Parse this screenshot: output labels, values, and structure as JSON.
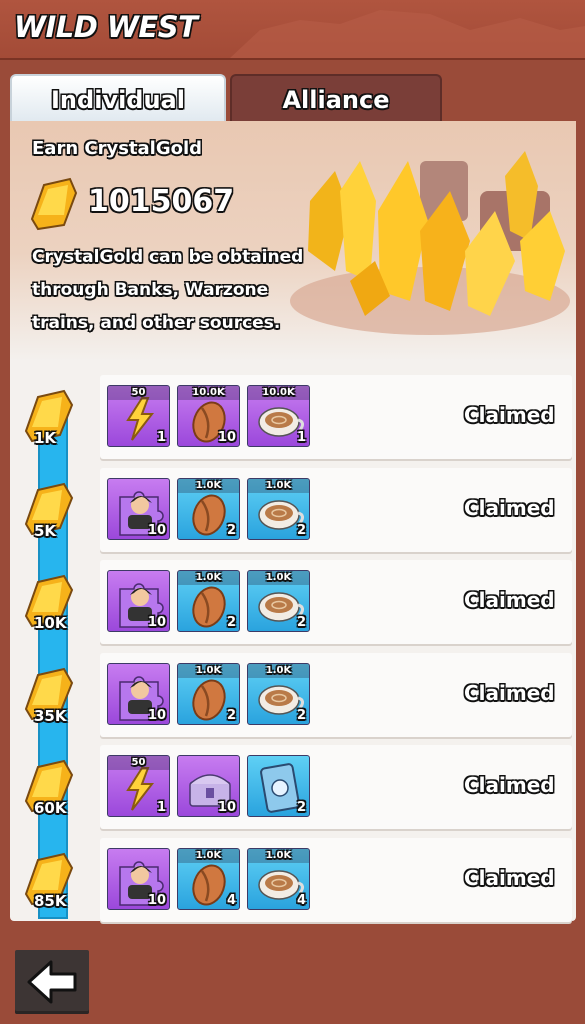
{
  "header": {
    "title": "WILD WEST"
  },
  "tabs": [
    {
      "label": "Individual",
      "active": true
    },
    {
      "label": "Alliance",
      "active": false
    }
  ],
  "hero": {
    "earn_label": "Earn CrystalGold",
    "amount": "1015067",
    "description": "CrystalGold can be obtained through Banks, Warzone trains, and other sources."
  },
  "rewards": [
    {
      "milestone": "1K",
      "status": "Claimed",
      "items": [
        {
          "icon": "energy-icon",
          "color": "purple",
          "top": "50",
          "qty": "1"
        },
        {
          "icon": "coffee-bean-icon",
          "color": "purple",
          "top": "10.0K",
          "qty": "10"
        },
        {
          "icon": "coffee-cup-icon",
          "color": "purple",
          "top": "10.0K",
          "qty": "1"
        }
      ]
    },
    {
      "milestone": "5K",
      "status": "Claimed",
      "items": [
        {
          "icon": "hero-puzzle-icon",
          "color": "purple",
          "top": "",
          "qty": "10"
        },
        {
          "icon": "coffee-bean-icon",
          "color": "blue",
          "top": "1.0K",
          "qty": "2"
        },
        {
          "icon": "coffee-cup-icon",
          "color": "blue",
          "top": "1.0K",
          "qty": "2"
        }
      ]
    },
    {
      "milestone": "10K",
      "status": "Claimed",
      "items": [
        {
          "icon": "hero-puzzle-icon",
          "color": "purple",
          "top": "",
          "qty": "10"
        },
        {
          "icon": "coffee-bean-icon",
          "color": "blue",
          "top": "1.0K",
          "qty": "2"
        },
        {
          "icon": "coffee-cup-icon",
          "color": "blue",
          "top": "1.0K",
          "qty": "2"
        }
      ]
    },
    {
      "milestone": "35K",
      "status": "Claimed",
      "items": [
        {
          "icon": "hero-puzzle-icon",
          "color": "purple",
          "top": "",
          "qty": "10"
        },
        {
          "icon": "coffee-bean-icon",
          "color": "blue",
          "top": "1.0K",
          "qty": "2"
        },
        {
          "icon": "coffee-cup-icon",
          "color": "blue",
          "top": "1.0K",
          "qty": "2"
        }
      ]
    },
    {
      "milestone": "60K",
      "status": "Claimed",
      "items": [
        {
          "icon": "energy-icon",
          "color": "purple",
          "top": "50",
          "qty": "1"
        },
        {
          "icon": "treasure-chest-icon",
          "color": "purple",
          "top": "",
          "qty": "10"
        },
        {
          "icon": "card-icon",
          "color": "blue",
          "top": "",
          "qty": "2"
        }
      ]
    },
    {
      "milestone": "85K",
      "status": "Claimed",
      "items": [
        {
          "icon": "hero-puzzle-icon",
          "color": "purple",
          "top": "",
          "qty": "10"
        },
        {
          "icon": "coffee-bean-icon",
          "color": "blue",
          "top": "1.0K",
          "qty": "4"
        },
        {
          "icon": "coffee-cup-icon",
          "color": "blue",
          "top": "1.0K",
          "qty": "4"
        }
      ]
    }
  ],
  "footer": {
    "back_icon": "back-arrow-icon"
  }
}
